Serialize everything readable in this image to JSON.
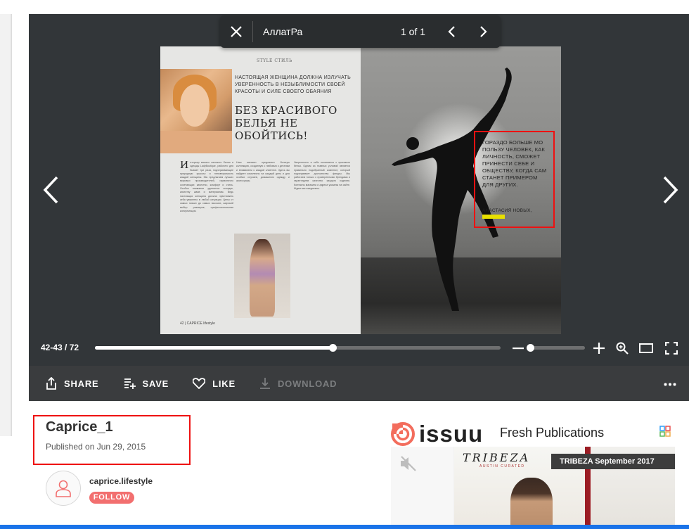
{
  "search": {
    "query": "АллатРа",
    "result_count": "1 of 1"
  },
  "magazine": {
    "kicker": "STYLE СТИЛЬ",
    "subheading": "НАСТОЯЩАЯ ЖЕНЩИНА ДОЛЖНА ИЗЛУЧАТЬ УВЕРЕННОСТЬ В НЕЗЫБЛИМОСТИ СВОЕЙ КРАСОТЫ И СИЛЕ СВОЕГО ОБАЯНИЯ",
    "headline": "БЕЗ КРАСИВОГО БЕЛЬЯ НЕ ОБОЙТИСЬ!",
    "quote": "ГОРАЗДО БОЛЬШЕ МО ПОЛЬЗУ ЧЕЛОВЕК, КАК ЛИЧНОСТЬ, СМОЖЕТ ПРИНЕСТИ СЕБЕ И ОБЩЕСТВУ, КОГДА САМ СТАНЕТ ПРИМЕРОМ ДЛЯ ДРУГИХ.",
    "quote_author": "АНАСТАСИЯ НОВЫХ,",
    "footer": "42 | CAPRICE lifestyle",
    "col1_dropcap": "И",
    "col1_text": "нтерьер вашего женского белья и одежды LadyBoutique, рабочего дня бывает три раза, подчеркивающие природную красоту и неповторимость каждой женщины. Мы предлагаем лучших мировых производителей, гармонично сочетающих качество, комфорт и стиль. Особое внимание уделяется посадке, качеству швов и материалам. Ведь настоящая женщина должна чувствовать себя уверенно в любой ситуации. Цены от самых низких до самых высоких, широкий выбор размеров, профессиональная консультация.",
    "col2_text": "Наш магазин предлагает богатую коллекцию, созданную с любовью к деталям и вниманием к каждой клиентке. Здесь вы найдете комплекты на каждый день и для особых случаев, домашнюю одежду и аксессуары.",
    "col3_text": "Уверенность в себе начинается с красивого белья. Одним из главных условий является правильно подобранный комплект, который подчеркивает достоинства фигуры. Мы работаем только с проверенными брендами и гарантируем качество каждого изделия. Контакты магазина и адреса указаны на сайте. Ждем вас ежедневно."
  },
  "viewer": {
    "page_indicator": "42-43 / 72",
    "progress_fraction": 0.585,
    "zoom_fraction": 0.03
  },
  "actions": {
    "share": "SHARE",
    "save": "SAVE",
    "like": "LIKE",
    "download": "DOWNLOAD"
  },
  "document": {
    "title": "Caprice_1",
    "published": "Published on Jun 29, 2015"
  },
  "publisher": {
    "name": "caprice.lifestyle",
    "follow_label": "FOLLOW"
  },
  "sidebar_ad": {
    "brand": "issuu",
    "heading": "Fresh Publications",
    "magazine_logo": "TRIBEZA",
    "magazine_sub": "AUSTIN CURATED",
    "banner": "TRIBEZA September 2017"
  },
  "colors": {
    "accent_red": "#e11111",
    "follow_coral": "#f26f6f",
    "viewer_bg": "#323639",
    "actionbar_bg": "#3a3c3e"
  },
  "icons": {
    "close": "close-icon",
    "prev_result": "chevron-left-icon",
    "next_result": "chevron-right-icon",
    "prev_page": "chevron-left-icon",
    "next_page": "chevron-right-icon",
    "zoom_in": "plus-icon",
    "zoom_out": "minus-icon",
    "search_zoom": "search-zoom-icon",
    "layout": "single-page-icon",
    "fullscreen": "fullscreen-icon",
    "share": "share-icon",
    "save": "save-icon",
    "like": "heart-icon",
    "download": "download-icon",
    "more": "more-icon",
    "avatar": "user-icon",
    "mute": "mute-icon",
    "adchoices": "adchoices-icon"
  }
}
